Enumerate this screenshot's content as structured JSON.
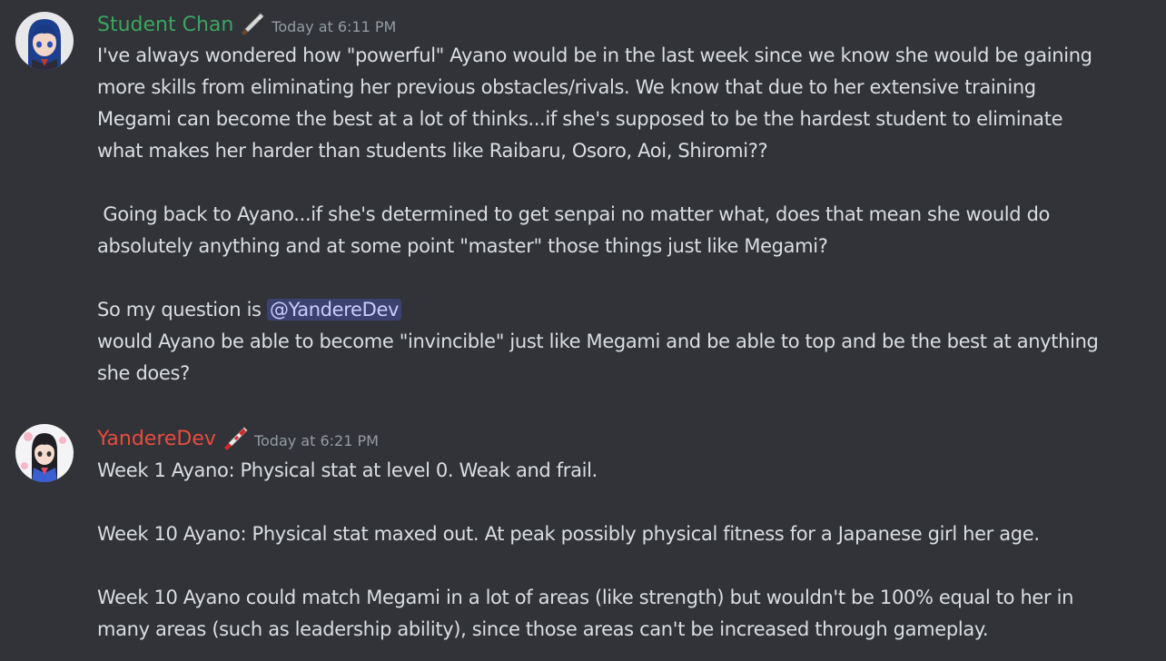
{
  "messages": [
    {
      "author": "Student Chan",
      "author_color": "#3ba55d",
      "role_icon": "knife-icon",
      "timestamp": "Today at 6:11 PM",
      "lines": [
        "I've always wondered how \"powerful\" Ayano would be in the last week since we know she would be gaining",
        "more skills from eliminating her previous obstacles/rivals. We know that due to her extensive training",
        "Megami can become the best at a lot of thinks...if she's supposed to be the hardest student to eliminate",
        "what makes her harder than students like Raibaru, Osoro, Aoi, Shiromi??",
        "",
        " Going back to Ayano...if she's determined to get senpai no matter what, does that mean she would do",
        "absolutely anything and at some point \"master\" those things just like Megami?",
        ""
      ],
      "question_prefix": "So my question is ",
      "mention": "@YandereDev",
      "after_mention_lines": [
        "would Ayano be able to become \"invincible\" just like Megami and be able to top and be the best at anything",
        "she does?"
      ]
    },
    {
      "author": "YandereDev",
      "author_color": "#e74c3c",
      "role_icon": "bloody-knife-icon",
      "timestamp": "Today at 6:21 PM",
      "lines": [
        "Week 1 Ayano: Physical stat at level 0. Weak and frail.",
        "",
        "Week 10 Ayano: Physical stat maxed out. At peak possibly physical fitness for a Japanese girl her age.",
        "",
        "Week 10 Ayano could match Megami in a lot of areas (like strength) but wouldn't be 100% equal to her in",
        "many areas (such as leadership ability), since those areas can't be increased through gameplay."
      ]
    }
  ]
}
